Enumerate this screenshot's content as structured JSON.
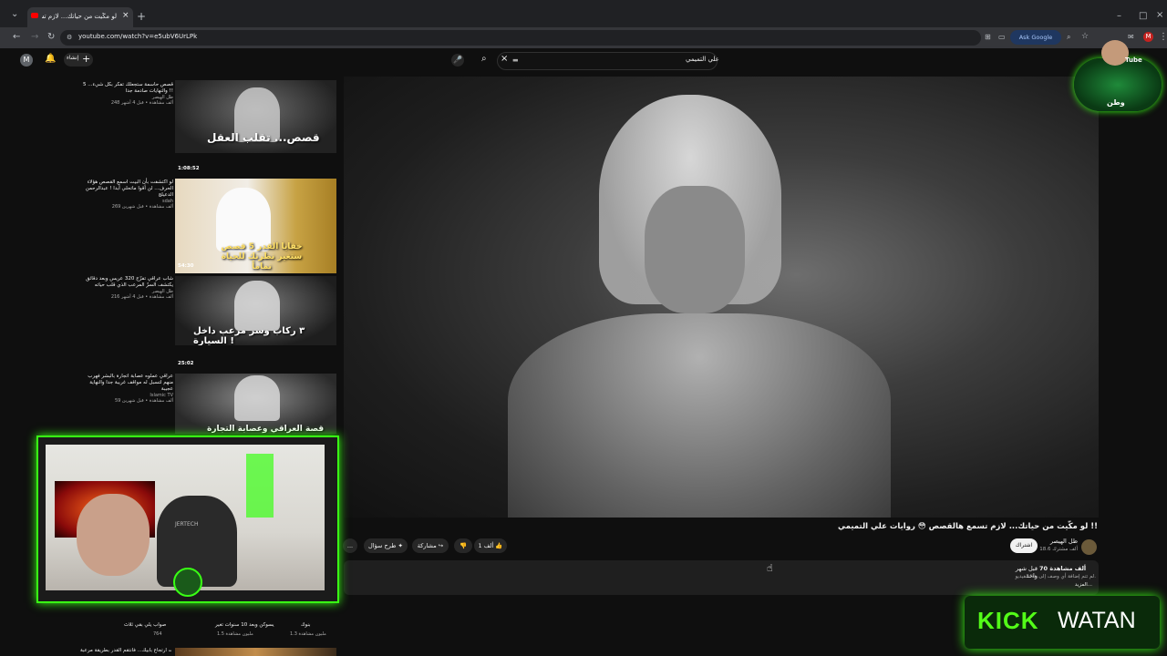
{
  "browser": {
    "tab_title": "لو مكّيت من حياتك... لازم تسم",
    "url": "youtube.com/watch?v=e5ubV6UrLPk",
    "ask_google": "Ask Google",
    "profile_initial": "M"
  },
  "header": {
    "create_label": "إنشاء",
    "search_value": "علي التميمي",
    "avatar_initial": "M"
  },
  "video": {
    "title": "لو مكّيت من حياتك... لازم تسمع هالقصص 😳 روايات علي التميمي !!",
    "channel": "ظل الهيصر",
    "subscribers": "18.6 ألف مشترك",
    "subscribe_label": "اشتراك",
    "likes": "1 ألف",
    "share_label": "مشاركة",
    "ask_label": "طرح سؤال",
    "more_label": "...",
    "views": "70 ألف مشاهدة",
    "date": "قبل شهر واحد",
    "desc_line1": "لم تتم إضافة أي وصف إلى هذا الفيديو.",
    "desc_more": "المزيد..."
  },
  "sidebar": {
    "items": [
      {
        "title": "5 قصص حاسمة ستجعلك تفكر بكل شيء... والنهايات صادمة جدا !!",
        "channel": "ظل الهيصر",
        "meta": "248 ألف مشاهدة • قبل 4 أشهر",
        "overlay": "قصص... تقلب العقل",
        "duration": "1:08:52"
      },
      {
        "title": "لو اكتشفت بأن البيت اسمع القصص هؤلاء الحرف... لن أقوا ماتحلي أبدا ! عبدالرحمن الدعيلج",
        "channel": "sdah",
        "meta": "269 ألف مشاهدة • قبل شهرين",
        "overlay": "خفايا القدر 5 قصص ستغير نظرتك للحياة تماماً",
        "duration": "54:30"
      },
      {
        "title": "شاب عراقي تفرّج 320 عريس وبعد دقائق يكتشف السرّ المرعب الذي قلب حياته",
        "channel": "ظل الهيصر",
        "meta": "216 ألف مشاهدة • قبل 4 أشهر",
        "overlay": "٣ ركاب وسر مرعب داخل السيارة !",
        "duration": "25:02"
      },
      {
        "title": "عراقي عملوه عصابة اتجارة بالبشر فهرب منهم لتسبل له مواقف غريبة جدا والنهاية عجيبة",
        "channel": "Islamic TV",
        "meta": "59 ألف مشاهدة • قبل شهرين",
        "overlay": "قصة العراقي وعصابة التجارة بالبشر",
        "duration": ""
      }
    ],
    "lower": [
      {
        "title": "صواب يلي بقي ثلاث",
        "meta": "764"
      },
      {
        "title": "يسوكن وبعد 10 سنوات تغير",
        "meta": "1.5 مليون مشاهدة"
      },
      {
        "title": "بنوك",
        "meta": "1.3 مليون مشاهدة"
      }
    ],
    "bottom_title": "رفضت ارتجاع بأبيك... فانتقم القدر بطريقة مرعبة!!"
  },
  "overlay": {
    "kick_k": "KICK",
    "kick_w": "WATAN",
    "logo_text": "Tube",
    "logo_sign": "وطن",
    "cam_brand": "JERTECH"
  },
  "colors": {
    "accent_green": "#53fc18",
    "yt_red": "#ff0000",
    "bg": "#0f0f0f"
  }
}
